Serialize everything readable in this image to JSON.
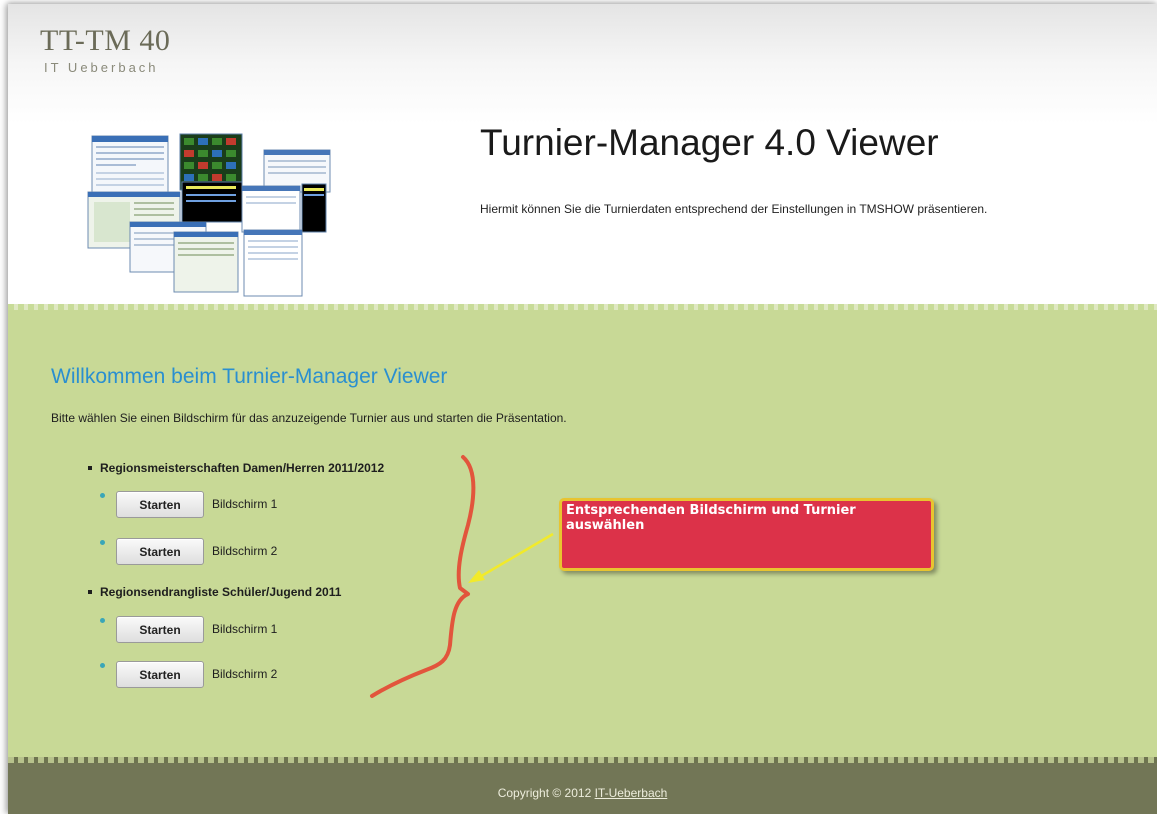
{
  "header": {
    "logo_title": "TT-TM 40",
    "logo_subtitle": "IT Ueberbach",
    "heading": "Turnier-Manager 4.0 Viewer",
    "subheading": "Hiermit können Sie die Turnierdaten entsprechend der Einstellungen in TMSHOW präsentieren.",
    "screenshots_image": "collage of application window screenshots"
  },
  "main": {
    "welcome": "Willkommen beim Turnier-Manager Viewer",
    "intro": "Bitte wählen Sie einen Bildschirm für das anzuzeigende Turnier aus und starten die Präsentation.",
    "tournaments": [
      {
        "name": "Regionsmeisterschaften Damen/Herren 2011/2012",
        "screens": [
          {
            "button": "Starten",
            "label": "Bildschirm 1"
          },
          {
            "button": "Starten",
            "label": "Bildschirm 2"
          }
        ]
      },
      {
        "name": "Regionsendrangliste Schüler/Jugend 2011",
        "screens": [
          {
            "button": "Starten",
            "label": "Bildschirm 1"
          },
          {
            "button": "Starten",
            "label": "Bildschirm 2"
          }
        ]
      }
    ]
  },
  "callout": {
    "text": "Entsprechenden Bildschirm und Turnier auswählen"
  },
  "footer": {
    "copyright": "Copyright © 2012",
    "link": "IT-Ueberbach"
  },
  "colors": {
    "main_background": "#c8d996",
    "footer_background": "#727656",
    "welcome_text": "#2a8fd0",
    "callout_fill": "#dc3249",
    "callout_border": "#e8c430",
    "annotation_line": "#e2553c",
    "arrow": "#f2ea2a"
  }
}
